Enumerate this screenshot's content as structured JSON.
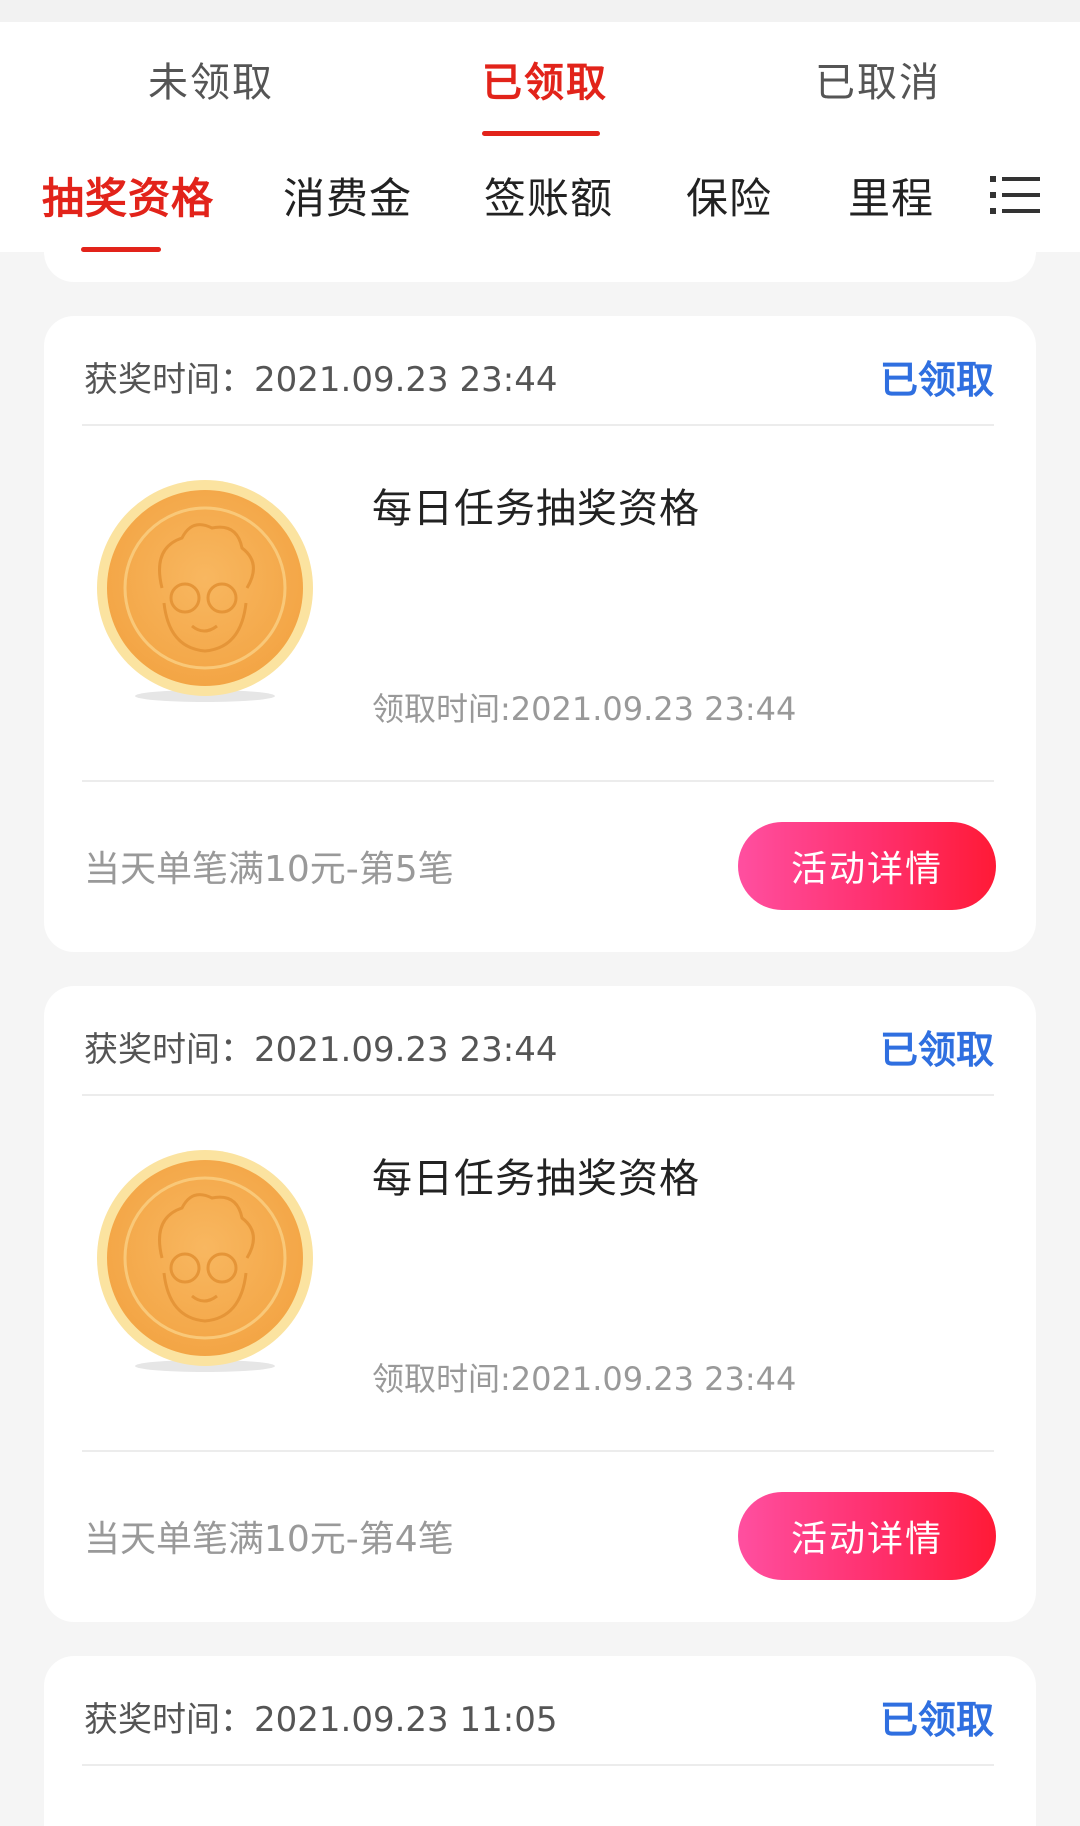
{
  "status_tabs": [
    {
      "label": "未领取"
    },
    {
      "label": "已领取",
      "active": true
    },
    {
      "label": "已取消"
    }
  ],
  "category_tabs": [
    {
      "label": "抽奖资格",
      "active": true
    },
    {
      "label": "消费金"
    },
    {
      "label": "签账额"
    },
    {
      "label": "保险"
    },
    {
      "label": "里程"
    }
  ],
  "menu_icon": "list-menu-icon",
  "cards": [
    {
      "award_time": "获奖时间：2021.09.23 23:44",
      "status": "已领取",
      "prize_title": "每日任务抽奖资格",
      "claim_time": "领取时间:2021.09.23 23:44",
      "rule": "当天单笔满10元-第5笔",
      "button": "活动详情"
    },
    {
      "award_time": "获奖时间：2021.09.23 23:44",
      "status": "已领取",
      "prize_title": "每日任务抽奖资格",
      "claim_time": "领取时间:2021.09.23 23:44",
      "rule": "当天单笔满10元-第4笔",
      "button": "活动详情"
    },
    {
      "award_time": "获奖时间：2021.09.23 11:05",
      "status": "已领取"
    }
  ],
  "colors": {
    "accent_red": "#e2231a",
    "claimed_blue": "#2f6fe0",
    "button_gradient_start": "#ff4fa0",
    "button_gradient_end": "#ff1a36",
    "coin_gold": "#f7b35a"
  }
}
